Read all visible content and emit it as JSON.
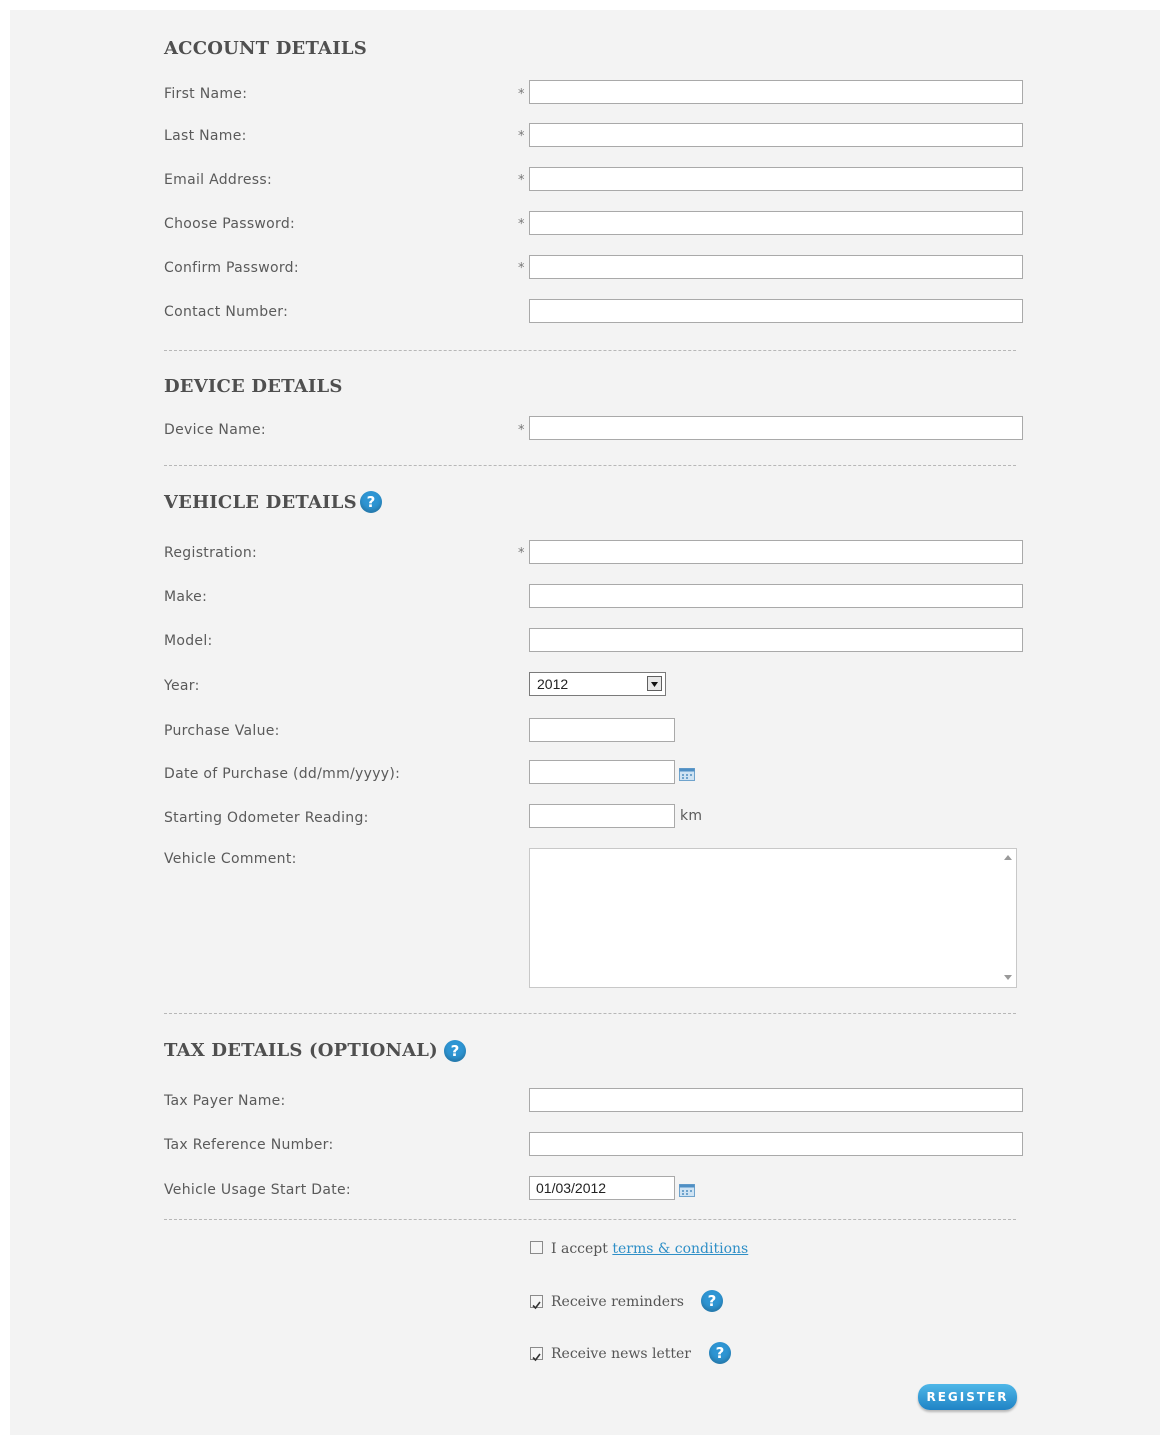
{
  "account": {
    "heading": "ACCOUNT DETAILS",
    "first_name_label": "First Name:",
    "last_name_label": "Last Name:",
    "email_label": "Email Address:",
    "password_label": "Choose Password:",
    "confirm_password_label": "Confirm Password:",
    "contact_label": "Contact Number:"
  },
  "device": {
    "heading": "DEVICE DETAILS",
    "device_name_label": "Device Name:"
  },
  "vehicle": {
    "heading": "VEHICLE DETAILS",
    "registration_label": "Registration:",
    "make_label": "Make:",
    "model_label": "Model:",
    "year_label": "Year:",
    "year_value": "2012",
    "purchase_value_label": "Purchase Value:",
    "date_of_purchase_label": "Date of Purchase (dd/mm/yyyy):",
    "odometer_label": "Starting Odometer Reading:",
    "odometer_unit": "km",
    "comment_label": "Vehicle Comment:"
  },
  "tax": {
    "heading": "TAX DETAILS (OPTIONAL)",
    "payer_name_label": "Tax Payer Name:",
    "reference_label": "Tax Reference Number:",
    "usage_start_label": "Vehicle Usage Start Date:",
    "usage_start_value": "01/03/2012"
  },
  "options": {
    "accept_prefix": "I accept ",
    "terms_link": "terms & conditions",
    "reminders_label": "Receive reminders",
    "newsletter_label": "Receive news letter",
    "accept_checked": false,
    "reminders_checked": true,
    "newsletter_checked": true
  },
  "register_label": "REGISTER",
  "required_marker": "*",
  "colors": {
    "accent": "#2e95d3",
    "link": "#2e8fc7",
    "panel": "#f3f3f3"
  }
}
